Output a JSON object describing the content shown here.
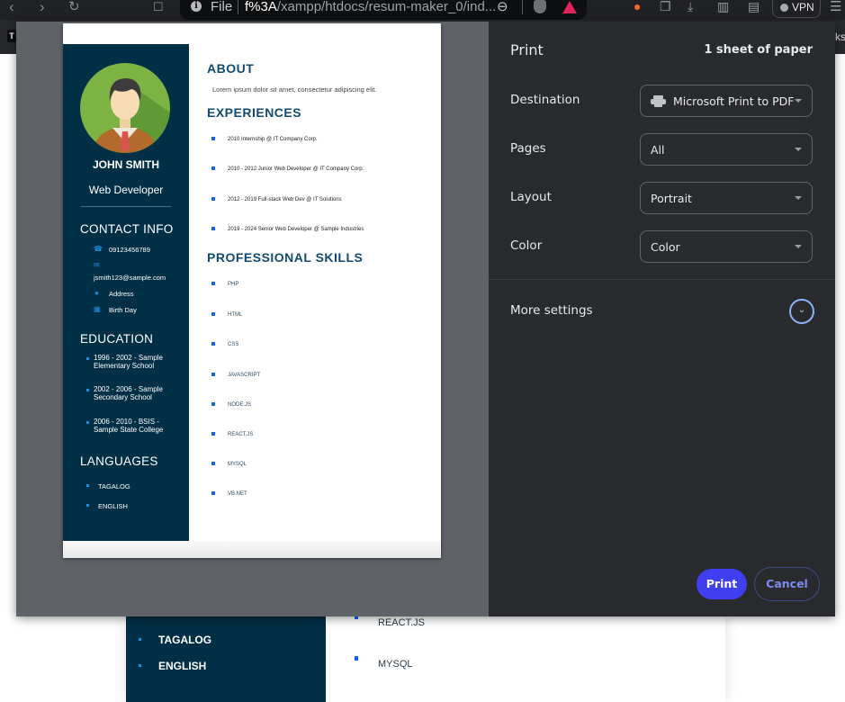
{
  "browser": {
    "address_prefix": "File",
    "url_host": "f%3A",
    "url_path": "/xampp/htdocs/resum-maker_0/ind...",
    "vpn_label": "VPN",
    "bookmarks_bar_fragment": "ks",
    "bookmark_icon_text": "T"
  },
  "resume": {
    "name": "JOHN SMITH",
    "role": "Web Developer",
    "contact_heading": "CONTACT INFO",
    "contact": {
      "phone": "09123456789",
      "email": "jsmith123@sample.com",
      "address": "Address",
      "birthday": "Birth Day"
    },
    "education_heading": "EDUCATION",
    "education": [
      "1996 - 2002 - Sample Elementary School",
      "2002 - 2006 - Sample Secondary School",
      "2006 - 2010 - BSIS - Sample State College"
    ],
    "languages_heading": "LANGUAGES",
    "languages": [
      "TAGALOG",
      "ENGLISH"
    ],
    "about_heading": "ABOUT",
    "about_text": "Lorem ipsum dolor sit amet, consectetur adipiscing elit.",
    "experiences_heading": "EXPERIENCES",
    "experiences": [
      "2010 Internship @ IT Company Corp.",
      "2010 - 2012 Junior Web Developer @ IT Company Corp.",
      "2012 - 2019 Full-stack Web Dev @ IT Solutions",
      "2019 - 2024 Senior Web Developer @ Sample Industries"
    ],
    "skills_heading": "PROFESSIONAL SKILLS",
    "skills": [
      "PHP",
      "HTML",
      "CSS",
      "JAVASCRIPT",
      "NODE.JS",
      "REACT.JS",
      "MYSQL",
      "VB.NET"
    ]
  },
  "background_page": {
    "languages": [
      "TAGALOG",
      "ENGLISH"
    ],
    "skills": [
      "REACT.JS",
      "MYSQL"
    ]
  },
  "print_dialog": {
    "title": "Print",
    "sheet_count": "1 sheet of paper",
    "destination_label": "Destination",
    "destination_value": "Microsoft Print to PDF",
    "pages_label": "Pages",
    "pages_value": "All",
    "layout_label": "Layout",
    "layout_value": "Portrait",
    "color_label": "Color",
    "color_value": "Color",
    "more_settings_label": "More settings",
    "print_button": "Print",
    "cancel_button": "Cancel"
  }
}
